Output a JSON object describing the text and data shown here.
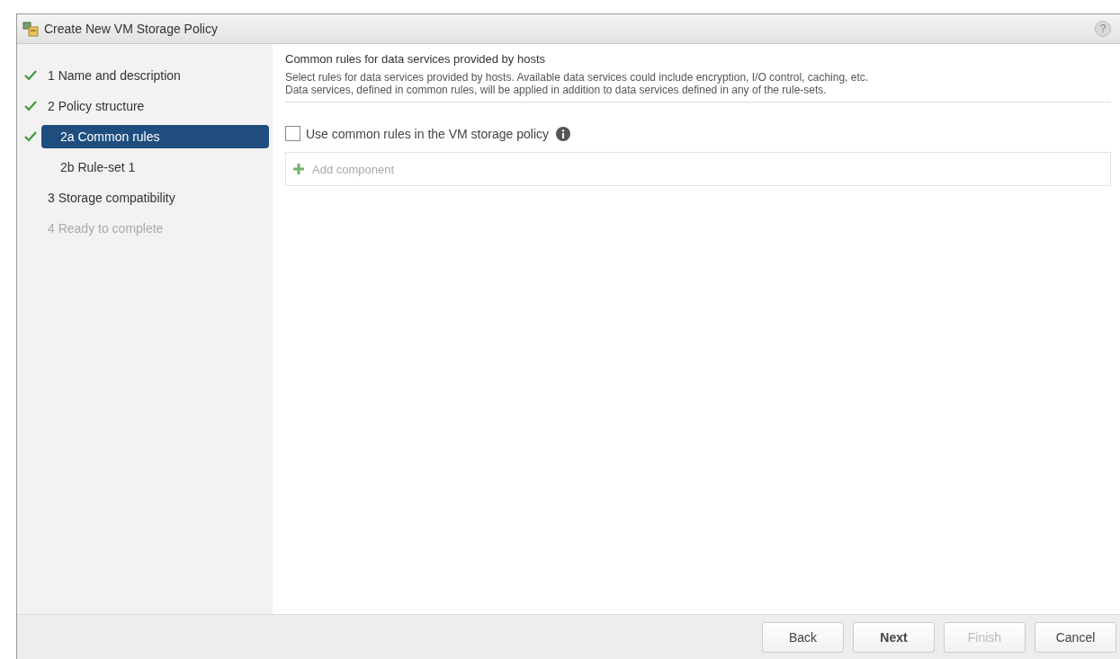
{
  "window": {
    "title": "Create New VM Storage Policy",
    "help": "?"
  },
  "steps": [
    {
      "label": "1  Name and description",
      "done": true,
      "selected": false,
      "disabled": false
    },
    {
      "label": "2  Policy structure",
      "done": true,
      "selected": false,
      "disabled": false,
      "children": [
        {
          "label": "2a  Common rules",
          "done": true,
          "selected": true,
          "disabled": false
        },
        {
          "label": "2b  Rule-set 1",
          "done": false,
          "selected": false,
          "disabled": false
        }
      ]
    },
    {
      "label": "3  Storage compatibility",
      "done": false,
      "selected": false,
      "disabled": false
    },
    {
      "label": "4  Ready to complete",
      "done": false,
      "selected": false,
      "disabled": true
    }
  ],
  "content": {
    "heading": "Common rules for data services provided by hosts",
    "description": [
      "Select rules for data services provided by hosts. Available data services could include encryption, I/O control, caching, etc.",
      "Data services, defined in common rules, will be applied in addition to data services defined in any of the rule-sets."
    ],
    "use_common_rules": {
      "label": "Use common rules in the VM storage policy",
      "checked": false
    },
    "add_component": {
      "label": "Add component",
      "disabled": true
    }
  },
  "buttons": [
    {
      "label": "Back",
      "disabled": false,
      "bold": false
    },
    {
      "label": "Next",
      "disabled": false,
      "bold": true
    },
    {
      "label": "Finish",
      "disabled": true,
      "bold": false
    },
    {
      "label": "Cancel",
      "disabled": false,
      "bold": false
    }
  ]
}
